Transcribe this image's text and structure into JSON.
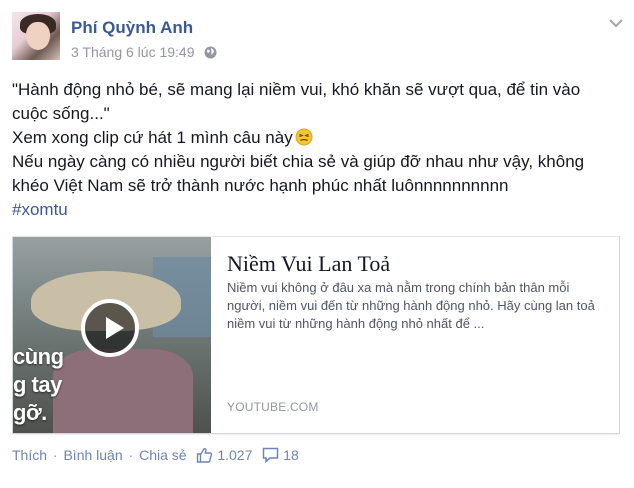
{
  "post": {
    "author": "Phí Quỳnh Anh",
    "timestamp": "3 Tháng 6 lúc 19:49",
    "privacy_icon": "globe-icon",
    "body_lines": [
      "\"Hành động nhỏ bé, sẽ mang lại niềm vui, khó khăn sẽ vượt qua, để tin vào",
      "cuộc sống...\"",
      "Xem xong clip cứ hát 1 mình câu này",
      "Nếu ngày càng có nhiều người biết chia sẻ và giúp đỡ nhau như vậy, không",
      "khéo Việt Nam sẽ trở thành nước hạnh phúc nhất luônnnnnnnnnn"
    ],
    "hashtag": "#xomtu",
    "emoji": "persevere-face-icon"
  },
  "link_card": {
    "title": "Niềm Vui Lan Toả",
    "description": "Niềm vui không ở đâu xa mà nằm trong chính bản thân mỗi người, niềm vui đến từ những hành động nhỏ. Hãy cùng lan toả niềm vui từ những hành động nhỏ nhất để ...",
    "source": "YOUTUBE.COM",
    "thumbnail_overlay_lines": [
      "cùng",
      "g tay",
      "gỡ."
    ]
  },
  "actions": {
    "like": "Thích",
    "comment": "Bình luận",
    "share": "Chia sẻ",
    "separator": "·",
    "like_count": "1.027",
    "comment_count": "18"
  },
  "colors": {
    "link_blue": "#3b5998",
    "action_blue": "#6d84b4",
    "meta_gray": "#9197a3",
    "text": "#141823"
  }
}
